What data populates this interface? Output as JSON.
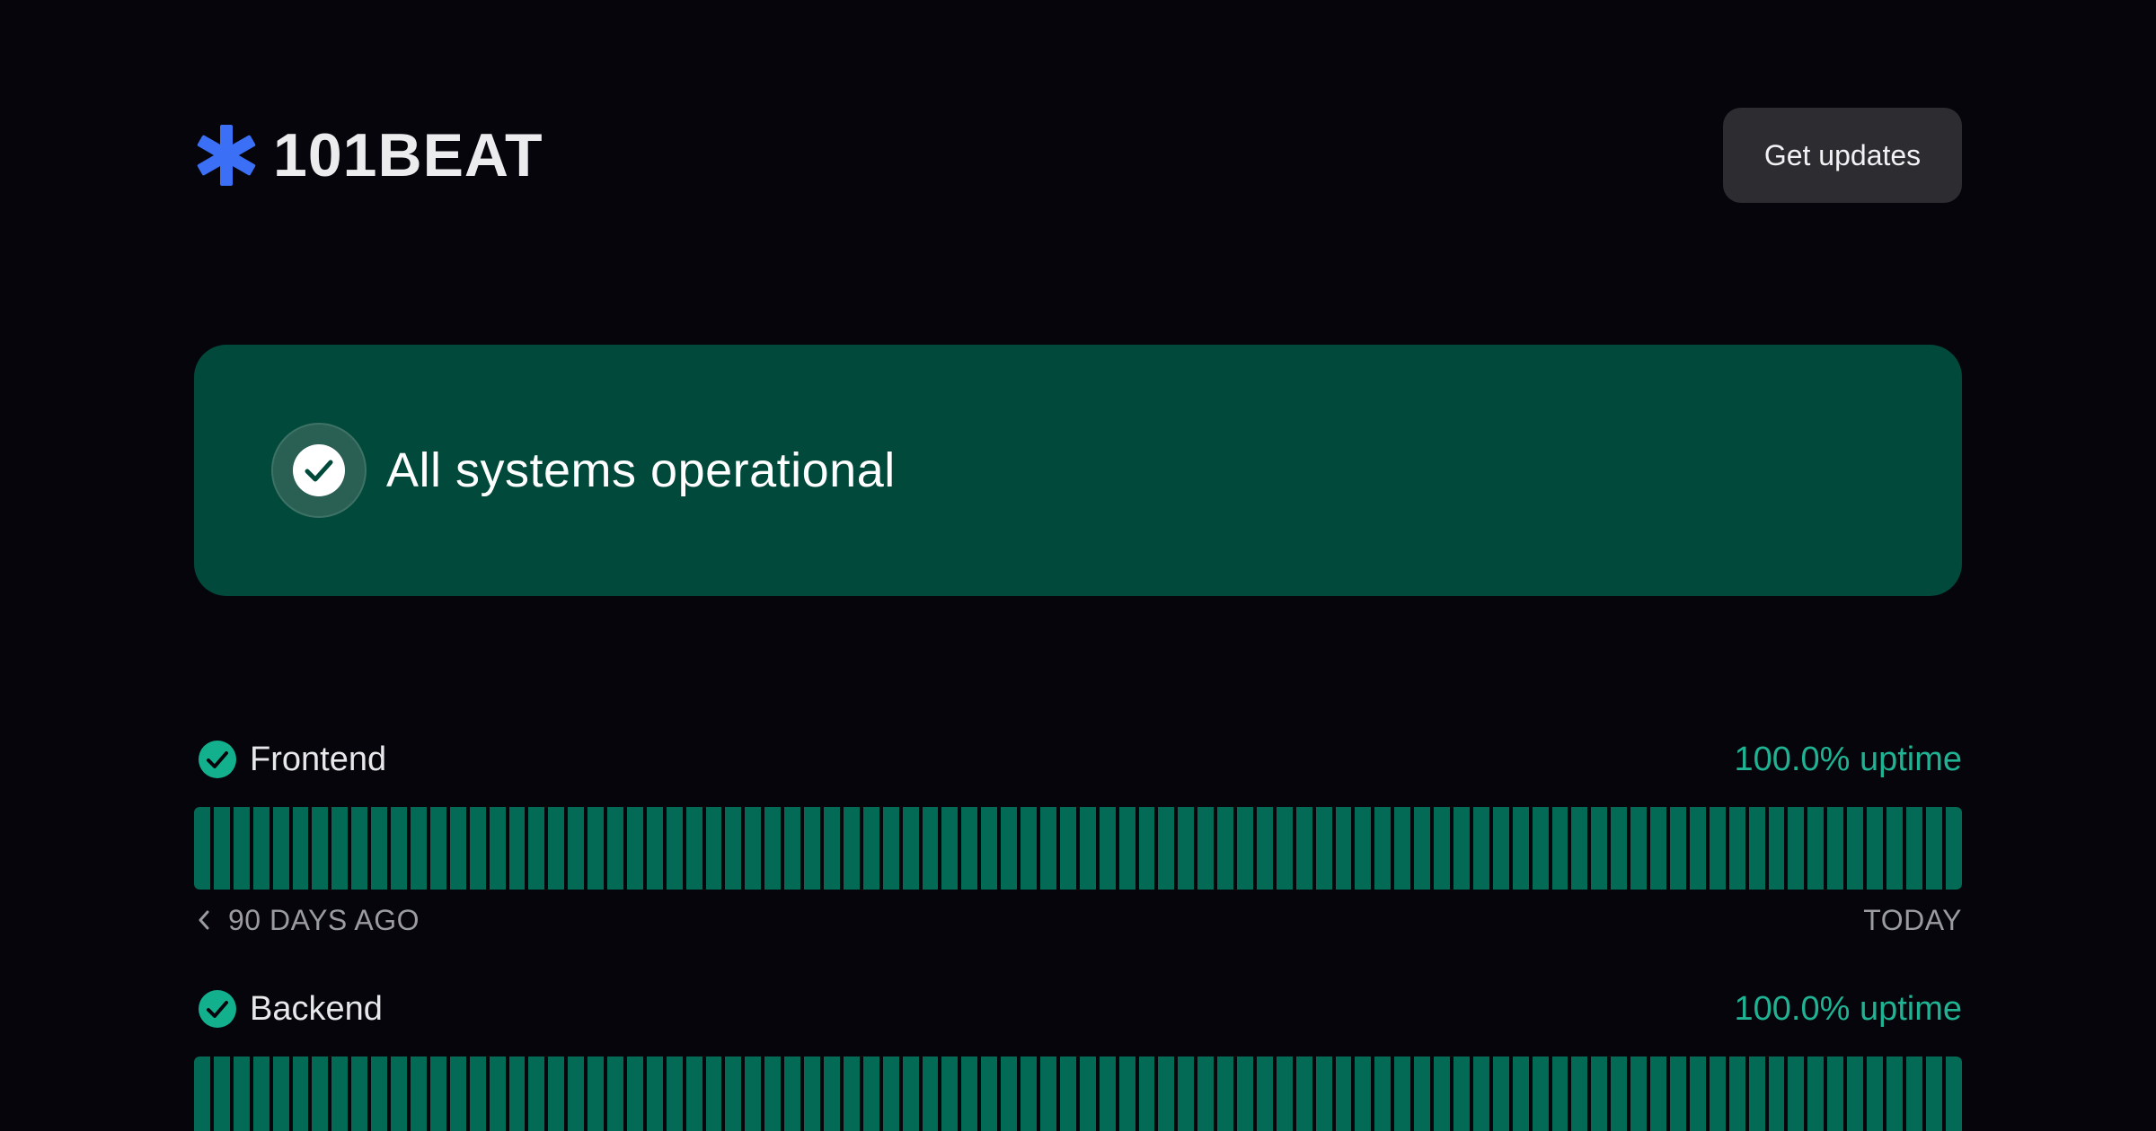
{
  "brand": {
    "name": "101BEAT",
    "icon": "asterisk-icon",
    "accent_color": "#3b6ff6"
  },
  "header": {
    "updates_label": "Get updates"
  },
  "status": {
    "text": "All systems operational",
    "icon": "check-circle-icon",
    "banner_color": "#01493b"
  },
  "components": [
    {
      "name": "Frontend",
      "status_icon": "check-circle-icon",
      "uptime_label": "100.0% uptime",
      "uptime_percent": 100.0,
      "days": 90,
      "bar_color": "#036b55",
      "range_start": "90 DAYS AGO",
      "range_end": "TODAY"
    },
    {
      "name": "Backend",
      "status_icon": "check-circle-icon",
      "uptime_label": "100.0% uptime",
      "uptime_percent": 100.0,
      "days": 90,
      "bar_color": "#036b55"
    }
  ]
}
